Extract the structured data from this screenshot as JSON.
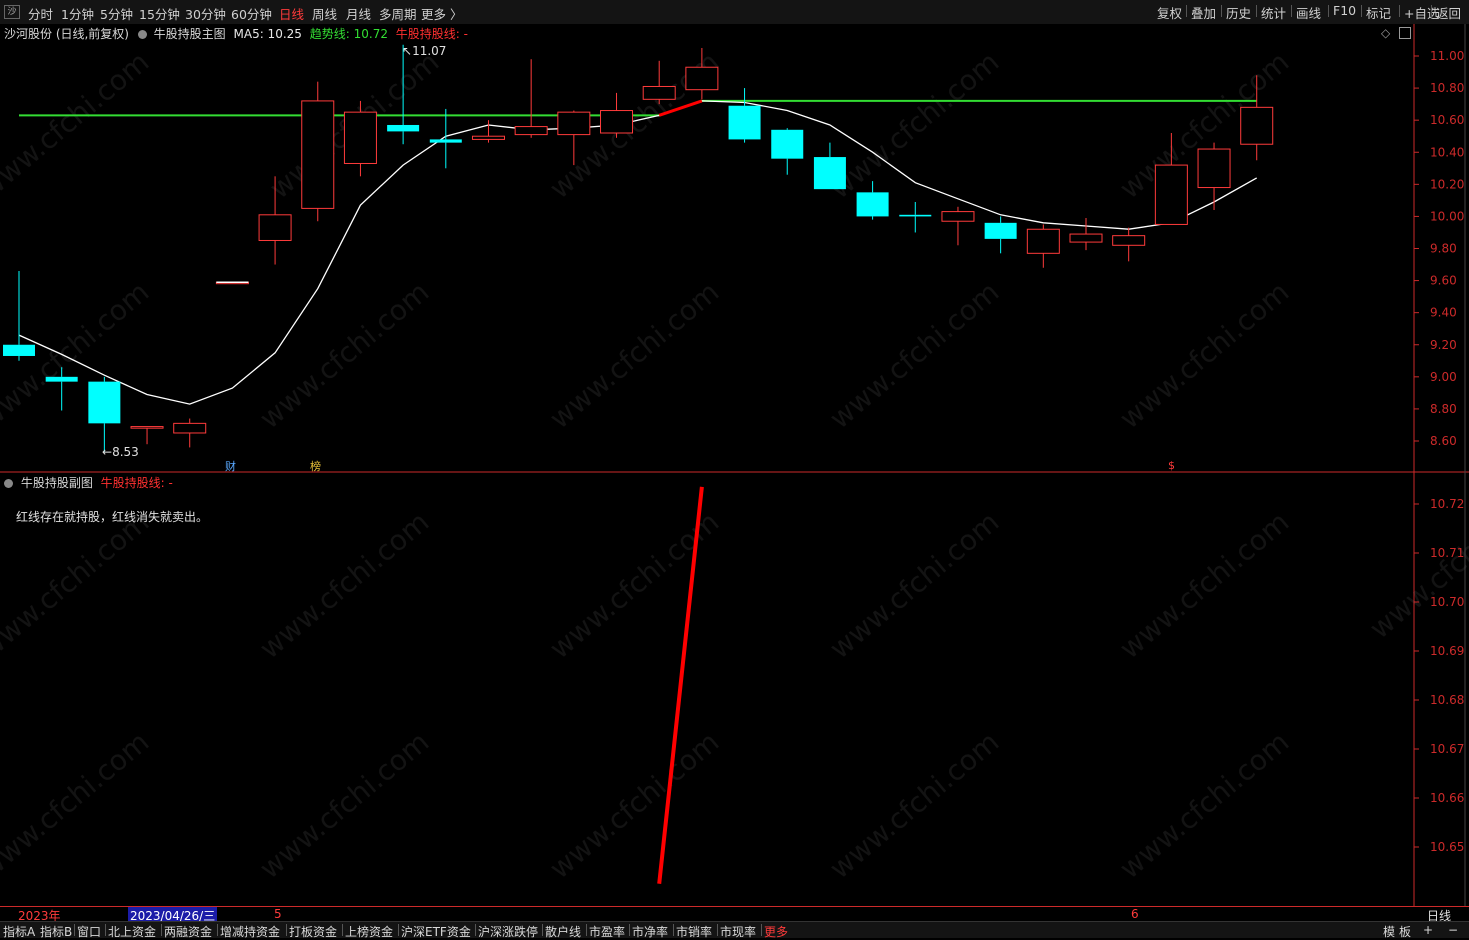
{
  "toolbar": {
    "win_icon": "沙",
    "periods": [
      "分时",
      "1分钟",
      "5分钟",
      "15分钟",
      "30分钟",
      "60分钟",
      "日线",
      "周线",
      "月线",
      "多周期",
      "更多 〉"
    ],
    "active_period": "日线",
    "right_buttons": [
      "复权",
      "叠加",
      "历史",
      "统计",
      "画线",
      "F10",
      "标记",
      "+自选",
      "返回"
    ]
  },
  "main_header": {
    "stock": "沙河股份 (日线,前复权)",
    "indicator": "牛股持股主图",
    "ma5": "MA5: 10.25",
    "trend": "趋势线: 10.72",
    "hold_line": "牛股持股线: -"
  },
  "sub_header": {
    "indicator": "牛股持股副图",
    "hold_line": "牛股持股线: -",
    "note": "红线存在就持股，红线消失就卖出。"
  },
  "annotations": {
    "high_label": "11.07",
    "low_label": "8.53",
    "badge_cai": "财",
    "badge_bang": "榜",
    "badge_s": "$"
  },
  "time_axis": {
    "year": "2023年",
    "cursor_date": "2023/04/26/三",
    "month_5": "5",
    "month_6": "6",
    "period_label": "日线"
  },
  "bottom_tabs": [
    "指标A",
    "指标B",
    "窗口",
    "北上资金",
    "两融资金",
    "增减持资金",
    "打板资金",
    "上榜资金",
    "沪深ETF资金",
    "沪深涨跌停",
    "散户线",
    "市盈率",
    "市净率",
    "市销率",
    "市现率",
    "更多"
  ],
  "bottom_right": [
    "模",
    "板",
    "+",
    "−"
  ],
  "watermark": "www.cfchi.com",
  "colors": {
    "up": "#ff3b3b",
    "down": "#00ffff",
    "ma5": "#ffffff",
    "trend": "#33dd33",
    "hold": "#ff0000",
    "axis": "#cc2a2a",
    "label_yellow": "#e8c038"
  },
  "chart_data": [
    {
      "type": "candlestick",
      "title": "牛股持股主图",
      "ylim": [
        8.5,
        11.1
      ],
      "yticks": [
        "11.00",
        "10.80",
        "10.60",
        "10.40",
        "10.20",
        "10.00",
        "9.80",
        "9.60",
        "9.40",
        "9.20",
        "9.00",
        "8.80",
        "8.60"
      ],
      "candles": [
        {
          "o": 9.2,
          "h": 9.66,
          "l": 9.1,
          "c": 9.13
        },
        {
          "o": 9.0,
          "h": 9.06,
          "l": 8.79,
          "c": 8.97
        },
        {
          "o": 8.97,
          "h": 9.0,
          "l": 8.53,
          "c": 8.71
        },
        {
          "o": 8.68,
          "h": 8.69,
          "l": 8.58,
          "c": 8.69
        },
        {
          "o": 8.65,
          "h": 8.74,
          "l": 8.56,
          "c": 8.71
        },
        {
          "o": 9.59,
          "h": 9.59,
          "l": 9.59,
          "c": 9.59
        },
        {
          "o": 9.85,
          "h": 10.25,
          "l": 9.7,
          "c": 10.01
        },
        {
          "o": 10.05,
          "h": 10.84,
          "l": 9.97,
          "c": 10.72
        },
        {
          "o": 10.33,
          "h": 10.72,
          "l": 10.25,
          "c": 10.65
        },
        {
          "o": 10.57,
          "h": 11.07,
          "l": 10.45,
          "c": 10.53
        },
        {
          "o": 10.48,
          "h": 10.67,
          "l": 10.3,
          "c": 10.46
        },
        {
          "o": 10.48,
          "h": 10.6,
          "l": 10.46,
          "c": 10.5
        },
        {
          "o": 10.51,
          "h": 10.98,
          "l": 10.49,
          "c": 10.56
        },
        {
          "o": 10.51,
          "h": 10.66,
          "l": 10.32,
          "c": 10.65
        },
        {
          "o": 10.52,
          "h": 10.77,
          "l": 10.49,
          "c": 10.66
        },
        {
          "o": 10.73,
          "h": 10.97,
          "l": 10.7,
          "c": 10.81
        },
        {
          "o": 10.79,
          "h": 11.05,
          "l": 10.73,
          "c": 10.93
        },
        {
          "o": 10.69,
          "h": 10.8,
          "l": 10.46,
          "c": 10.48
        },
        {
          "o": 10.54,
          "h": 10.55,
          "l": 10.26,
          "c": 10.36
        },
        {
          "o": 10.37,
          "h": 10.46,
          "l": 10.17,
          "c": 10.17
        },
        {
          "o": 10.15,
          "h": 10.22,
          "l": 9.98,
          "c": 10.0
        },
        {
          "o": 10.01,
          "h": 10.09,
          "l": 9.9,
          "c": 10.0
        },
        {
          "o": 9.97,
          "h": 10.06,
          "l": 9.82,
          "c": 10.03
        },
        {
          "o": 9.96,
          "h": 10.0,
          "l": 9.77,
          "c": 9.86
        },
        {
          "o": 9.77,
          "h": 9.95,
          "l": 9.68,
          "c": 9.92
        },
        {
          "o": 9.84,
          "h": 9.99,
          "l": 9.79,
          "c": 9.89
        },
        {
          "o": 9.82,
          "h": 9.93,
          "l": 9.72,
          "c": 9.88
        },
        {
          "o": 9.95,
          "h": 10.52,
          "l": 9.95,
          "c": 10.32
        },
        {
          "o": 10.18,
          "h": 10.46,
          "l": 10.04,
          "c": 10.42
        },
        {
          "o": 10.45,
          "h": 10.88,
          "l": 10.35,
          "c": 10.68
        }
      ],
      "ma5": [
        9.26,
        9.14,
        9.01,
        8.89,
        8.83,
        8.93,
        9.15,
        9.55,
        10.07,
        10.32,
        10.5,
        10.57,
        10.54,
        10.55,
        10.57,
        10.63,
        10.72,
        10.71,
        10.66,
        10.57,
        10.4,
        10.21,
        10.11,
        10.01,
        9.96,
        9.94,
        9.92,
        9.96,
        10.09,
        10.24
      ],
      "trend_line": {
        "from_index": 0,
        "to_index": 29,
        "values": [
          10.63,
          10.63,
          10.63,
          10.63,
          10.63,
          10.63,
          10.63,
          10.63,
          10.63,
          10.63,
          10.63,
          10.63,
          10.63,
          10.63,
          10.63,
          10.63,
          10.72,
          10.72,
          10.72,
          10.72,
          10.72,
          10.72,
          10.72,
          10.72,
          10.72,
          10.72,
          10.72,
          10.72,
          10.72,
          10.72
        ]
      },
      "hold_segment": [
        {
          "index": 15,
          "value": 10.63
        },
        {
          "index": 16,
          "value": 10.72
        }
      ]
    },
    {
      "type": "line",
      "title": "牛股持股副图",
      "ylim": [
        10.642,
        10.726
      ],
      "yticks": [
        "10.72",
        "10.71",
        "10.70",
        "10.69",
        "10.68",
        "10.67",
        "10.66",
        "10.65"
      ],
      "hold_segment": [
        {
          "index": 15,
          "value": 10.6425
        },
        {
          "index": 16,
          "value": 10.7235
        }
      ]
    }
  ]
}
